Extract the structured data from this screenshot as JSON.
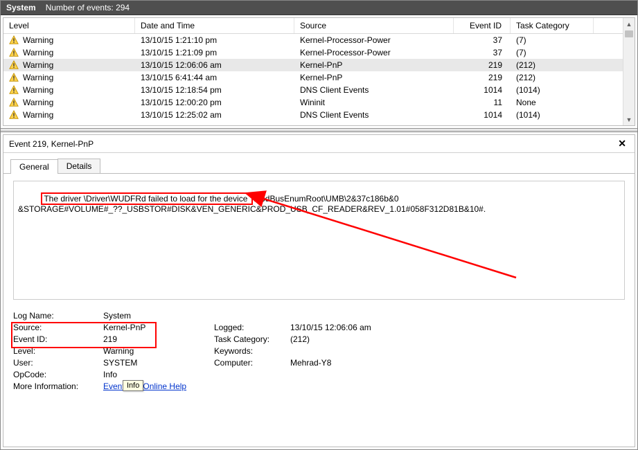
{
  "header": {
    "system_label": "System",
    "events_label": "Number of events: 294"
  },
  "columns": {
    "level": "Level",
    "datetime": "Date and Time",
    "source": "Source",
    "event_id": "Event ID",
    "task_category": "Task Category"
  },
  "rows": [
    {
      "level": "Warning",
      "datetime": "13/10/15 1:21:10 pm",
      "source": "Kernel-Processor-Power",
      "event_id": "37",
      "task_category": "(7)"
    },
    {
      "level": "Warning",
      "datetime": "13/10/15 1:21:09 pm",
      "source": "Kernel-Processor-Power",
      "event_id": "37",
      "task_category": "(7)"
    },
    {
      "level": "Warning",
      "datetime": "13/10/15 12:06:06 am",
      "source": "Kernel-PnP",
      "event_id": "219",
      "task_category": "(212)",
      "selected": true
    },
    {
      "level": "Warning",
      "datetime": "13/10/15 6:41:44 am",
      "source": "Kernel-PnP",
      "event_id": "219",
      "task_category": "(212)"
    },
    {
      "level": "Warning",
      "datetime": "13/10/15 12:18:54 pm",
      "source": "DNS Client Events",
      "event_id": "1014",
      "task_category": "(1014)"
    },
    {
      "level": "Warning",
      "datetime": "13/10/15 12:00:20 pm",
      "source": "Wininit",
      "event_id": "11",
      "task_category": "None"
    },
    {
      "level": "Warning",
      "datetime": "13/10/15 12:25:02 am",
      "source": "DNS Client Events",
      "event_id": "1014",
      "task_category": "(1014)"
    }
  ],
  "detail": {
    "pane_title": "Event 219, Kernel-PnP",
    "tabs": {
      "general": "General",
      "details": "Details"
    },
    "message_highlight": "The driver \\Driver\\WUDFRd failed to load for the device ",
    "message_rest": "WpdBusEnumRoot\\UMB\\2&37c186b&0\n&STORAGE#VOLUME#_??_USBSTOR#DISK&VEN_GENERIC&PROD_USB_CF_READER&REV_1.01#058F312D81B&10#.",
    "fields": {
      "log_name_label": "Log Name:",
      "log_name": "System",
      "source_label": "Source:",
      "source": "Kernel-PnP",
      "logged_label": "Logged:",
      "logged": "13/10/15 12:06:06 am",
      "event_id_label": "Event ID:",
      "event_id": "219",
      "task_category_label": "Task Category:",
      "task_category": "(212)",
      "level_label": "Level:",
      "level": "Warning",
      "keywords_label": "Keywords:",
      "keywords": "",
      "user_label": "User:",
      "user": "SYSTEM",
      "computer_label": "Computer:",
      "computer": "Mehrad-Y8",
      "opcode_label": "OpCode:",
      "opcode": "Info",
      "more_info_label": "More Information:",
      "more_info_link": "Event Log Online Help"
    },
    "tooltip": "Info",
    "close_label": "✕"
  }
}
